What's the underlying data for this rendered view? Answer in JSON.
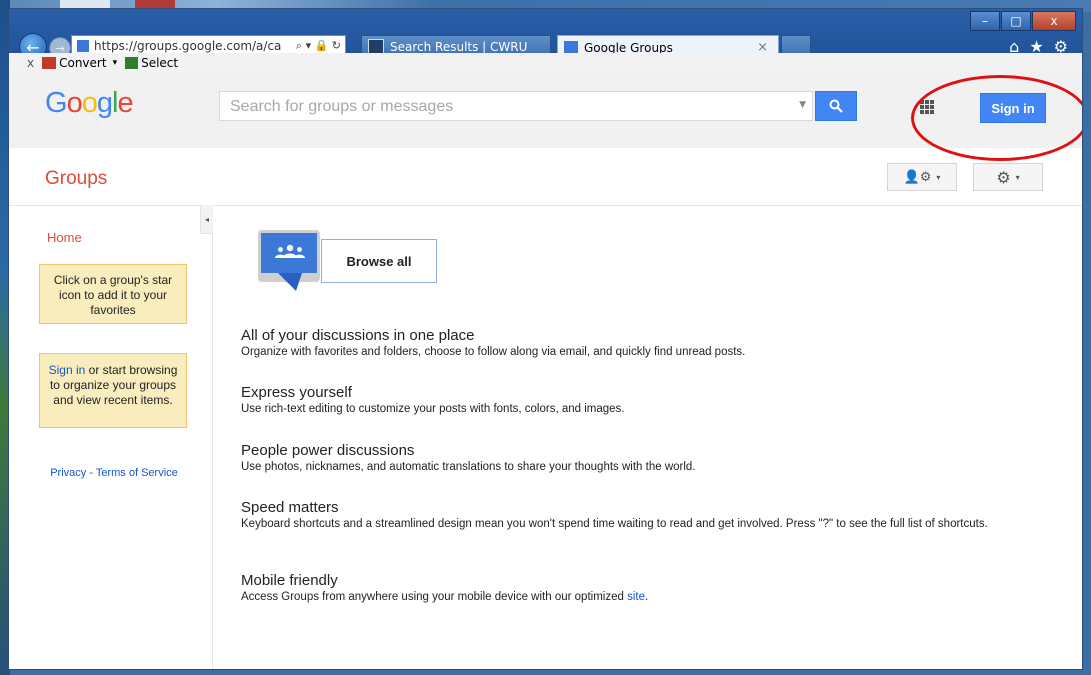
{
  "browser": {
    "address_url": "https://groups.google.com/a/ca",
    "address_icons": "⌕ ▾ 🔒 ↻",
    "tabs": [
      {
        "label": "Search Results | CWRU"
      },
      {
        "label": "Google Groups",
        "close": "×"
      }
    ],
    "window_controls": {
      "minimize": "–",
      "maximize": "□",
      "close": "x"
    },
    "right_icons": {
      "home": "⌂",
      "favorites": "★",
      "tools": "⚙"
    },
    "commandbar": {
      "close": "x",
      "convert_label": "Convert",
      "convert_caret": "▾",
      "select_label": "Select"
    }
  },
  "header": {
    "logo": [
      {
        "ch": "G",
        "color": "#4285f4"
      },
      {
        "ch": "o",
        "color": "#ea4335"
      },
      {
        "ch": "o",
        "color": "#fbbc05"
      },
      {
        "ch": "g",
        "color": "#4285f4"
      },
      {
        "ch": "l",
        "color": "#34a853"
      },
      {
        "ch": "e",
        "color": "#ea4335"
      }
    ],
    "search_placeholder": "Search for groups or messages",
    "search_dropdown": "▼",
    "signin_label": "Sign in"
  },
  "groups_bar": {
    "title": "Groups",
    "people_button": "👤⚙",
    "settings_button": "⚙",
    "caret": "▾"
  },
  "sidebar": {
    "collapse": "◂",
    "home": "Home",
    "star_note": "Click on a group's star icon to add it to your favorites",
    "signin_link": "Sign in",
    "signin_note_rest": " or start browsing to organize your groups and view recent items.",
    "privacy": "Privacy",
    "separator": " - ",
    "terms": "Terms of Service"
  },
  "main": {
    "browse_all": "Browse all",
    "features": [
      {
        "title": "All of your discussions in one place",
        "text": "Organize with favorites and folders, choose to follow along via email, and quickly find unread posts."
      },
      {
        "title": "Express yourself",
        "text": "Use rich-text editing to customize your posts with fonts, colors, and images."
      },
      {
        "title": "People power discussions",
        "text": "Use photos, nicknames, and automatic translations to share your thoughts with the world."
      },
      {
        "title": "Speed matters",
        "text": "Keyboard shortcuts and a streamlined design mean you won't spend time waiting to read and get involved. Press \"?\" to see the full list of shortcuts."
      },
      {
        "title": "Mobile friendly",
        "text": "Access Groups from anywhere using your mobile device with our optimized ",
        "link": "site",
        "after": "."
      }
    ]
  },
  "colors": {
    "accent_red": "#dd4b39",
    "button_blue": "#4285f4",
    "link_blue": "#1155cc",
    "annotation_red": "#e01010"
  }
}
